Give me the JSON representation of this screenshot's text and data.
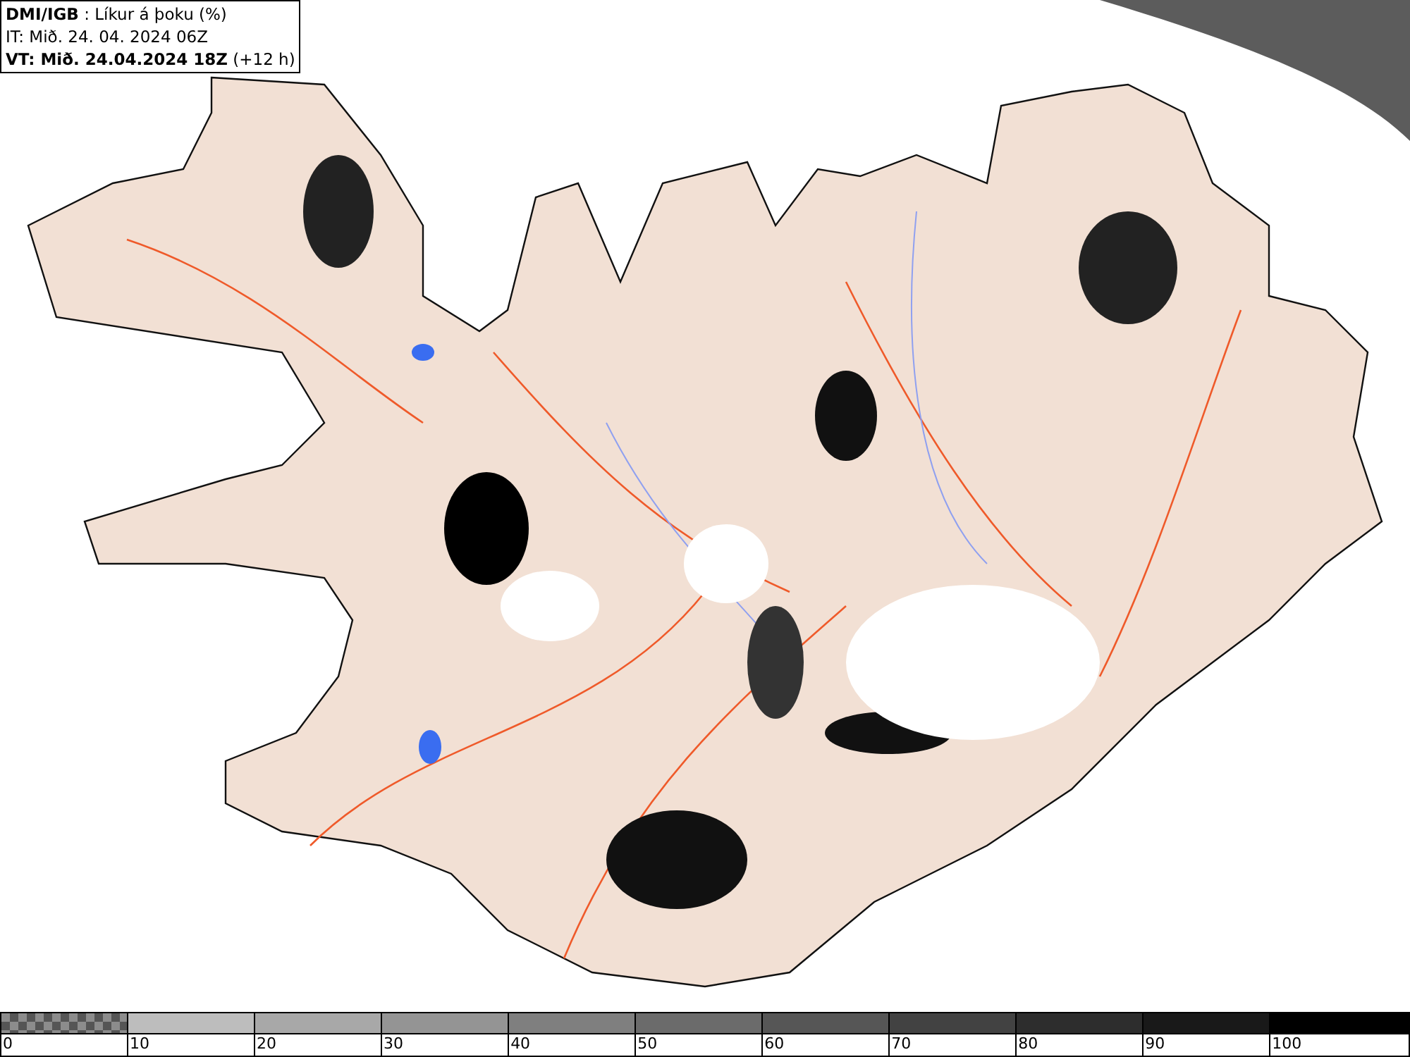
{
  "header": {
    "lines": [
      "**DMI/IGB** : Líkur á þoku (%)",
      "IT: Mið. 24. 04. 2024 06Z",
      "**VT: Mið. 24.04.2024 18Z** (+12 h)"
    ]
  },
  "colorbar": {
    "segments": [
      {
        "kind": "pattern",
        "color": "#8c8c8c",
        "label": "0"
      },
      {
        "kind": "solid",
        "color": "#bdbdbd",
        "label": "10"
      },
      {
        "kind": "solid",
        "color": "#a8a8a8",
        "label": "20"
      },
      {
        "kind": "solid",
        "color": "#949494",
        "label": "30"
      },
      {
        "kind": "solid",
        "color": "#7f7f7f",
        "label": "40"
      },
      {
        "kind": "solid",
        "color": "#6b6b6b",
        "label": "50"
      },
      {
        "kind": "solid",
        "color": "#565656",
        "label": "60"
      },
      {
        "kind": "solid",
        "color": "#424242",
        "label": "70"
      },
      {
        "kind": "solid",
        "color": "#2d2d2d",
        "label": "80"
      },
      {
        "kind": "solid",
        "color": "#191919",
        "label": "90"
      },
      {
        "kind": "solid",
        "color": "#000000",
        "label": "100"
      }
    ]
  }
}
